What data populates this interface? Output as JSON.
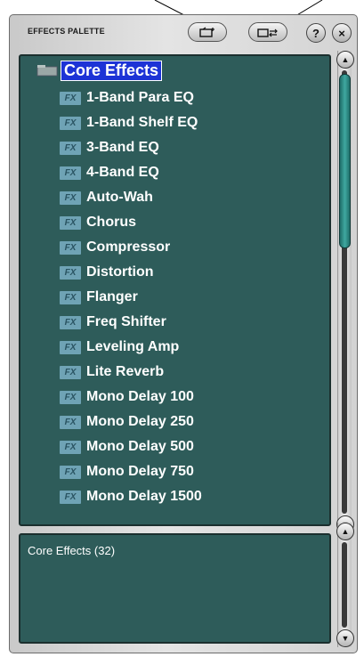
{
  "window": {
    "title": "EFFECTS PALETTE",
    "buttons": {
      "new_folder_icon": "new-folder-icon",
      "move_icon": "move-icon",
      "help": "?",
      "close": "×"
    }
  },
  "tree": {
    "root": {
      "label": "Core Effects",
      "icon": "folder-icon"
    },
    "item_badge": "FX",
    "items": [
      {
        "label": "1-Band Para EQ"
      },
      {
        "label": "1-Band Shelf EQ"
      },
      {
        "label": "3-Band EQ"
      },
      {
        "label": "4-Band EQ"
      },
      {
        "label": "Auto-Wah"
      },
      {
        "label": "Chorus"
      },
      {
        "label": "Compressor"
      },
      {
        "label": "Distortion"
      },
      {
        "label": "Flanger"
      },
      {
        "label": "Freq Shifter"
      },
      {
        "label": "Leveling Amp"
      },
      {
        "label": "Lite Reverb"
      },
      {
        "label": "Mono Delay  100"
      },
      {
        "label": "Mono Delay  250"
      },
      {
        "label": "Mono Delay  500"
      },
      {
        "label": "Mono Delay  750"
      },
      {
        "label": "Mono Delay  1500"
      }
    ]
  },
  "status": {
    "text": "Core Effects (32)"
  },
  "colors": {
    "panel_bg": "#2e5c5a",
    "selection": "#1d33d6",
    "thumb": "#3fa8a0"
  }
}
